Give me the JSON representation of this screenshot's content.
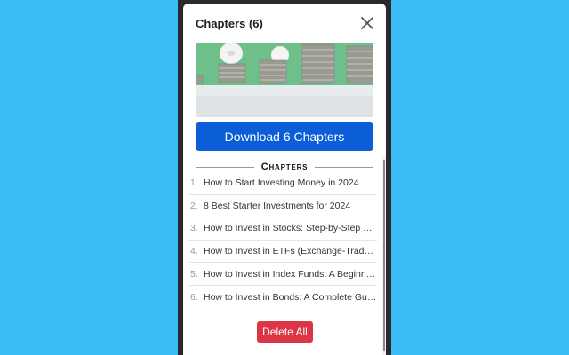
{
  "header": {
    "title": "Chapters (6)",
    "close_icon": "close-icon"
  },
  "hero": {
    "alt": "piggy-banks-on-coin-stacks"
  },
  "actions": {
    "download_label": "Download 6 Chapters",
    "delete_label": "Delete All"
  },
  "section": {
    "heading": "Chapters"
  },
  "chapters": [
    {
      "num": "1.",
      "title": "How to Start Investing Money in 2024"
    },
    {
      "num": "2.",
      "title": "8 Best Starter Investments for 2024"
    },
    {
      "num": "3.",
      "title": "How to Invest in Stocks: Step-by-Step Guide"
    },
    {
      "num": "4.",
      "title": "How to Invest in ETFs (Exchange-Traded Funds)"
    },
    {
      "num": "5.",
      "title": "How to Invest in Index Funds: A Beginner's Guide"
    },
    {
      "num": "6.",
      "title": "How to Invest in Bonds: A Complete Guide"
    }
  ],
  "colors": {
    "background": "#3bbcf5",
    "primary": "#0b5ed7",
    "danger": "#dc3545"
  }
}
